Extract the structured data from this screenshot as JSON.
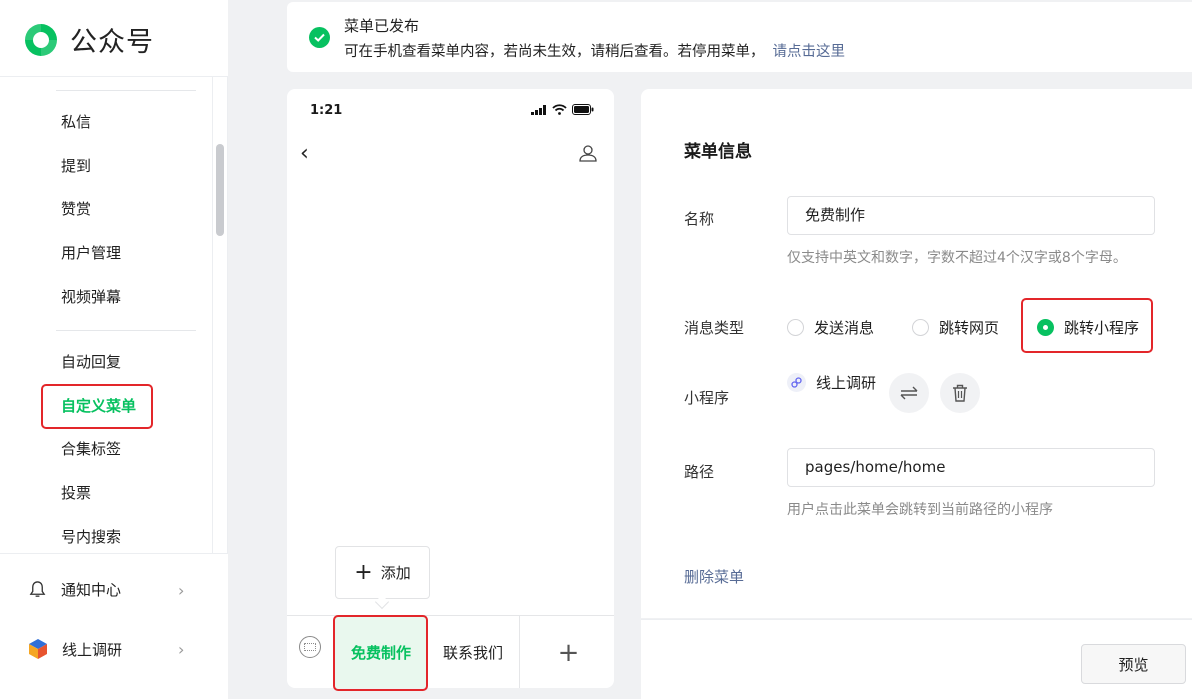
{
  "app": {
    "logo_text": "公众号"
  },
  "sidebar": {
    "items": [
      {
        "label": "私信"
      },
      {
        "label": "提到"
      },
      {
        "label": "赞赏"
      },
      {
        "label": "用户管理"
      },
      {
        "label": "视频弹幕"
      },
      {
        "label": "自动回复"
      },
      {
        "label": "自定义菜单"
      },
      {
        "label": "合集标签"
      },
      {
        "label": "投票"
      },
      {
        "label": "号内搜索"
      }
    ],
    "bottom": [
      {
        "label": "通知中心",
        "icon": "bell-icon"
      },
      {
        "label": "线上调研",
        "icon": "box-icon"
      }
    ]
  },
  "notice": {
    "title": "菜单已发布",
    "desc": "可在手机查看菜单内容，若尚未生效，请稍后查看。若停用菜单，",
    "link": "请点击这里"
  },
  "phone": {
    "time": "1:21",
    "popup_add": "添加",
    "tabs": [
      {
        "label": "免费制作",
        "active": true
      },
      {
        "label": "联系我们",
        "active": false
      }
    ]
  },
  "form": {
    "title": "菜单信息",
    "name_label": "名称",
    "name_value": "免费制作",
    "name_hint": "仅支持中英文和数字，字数不超过4个汉字或8个字母。",
    "type_label": "消息类型",
    "type_options": [
      {
        "label": "发送消息",
        "checked": false
      },
      {
        "label": "跳转网页",
        "checked": false
      },
      {
        "label": "跳转小程序",
        "checked": true
      }
    ],
    "miniprogram_label": "小程序",
    "miniprogram_name": "线上调研",
    "path_label": "路径",
    "path_value": "pages/home/home",
    "path_hint": "用户点击此菜单会跳转到当前路径的小程序",
    "delete_label": "删除菜单",
    "preview_label": "预览"
  },
  "colors": {
    "accent": "#07c160",
    "link": "#576b95",
    "highlight": "#e3262a"
  }
}
